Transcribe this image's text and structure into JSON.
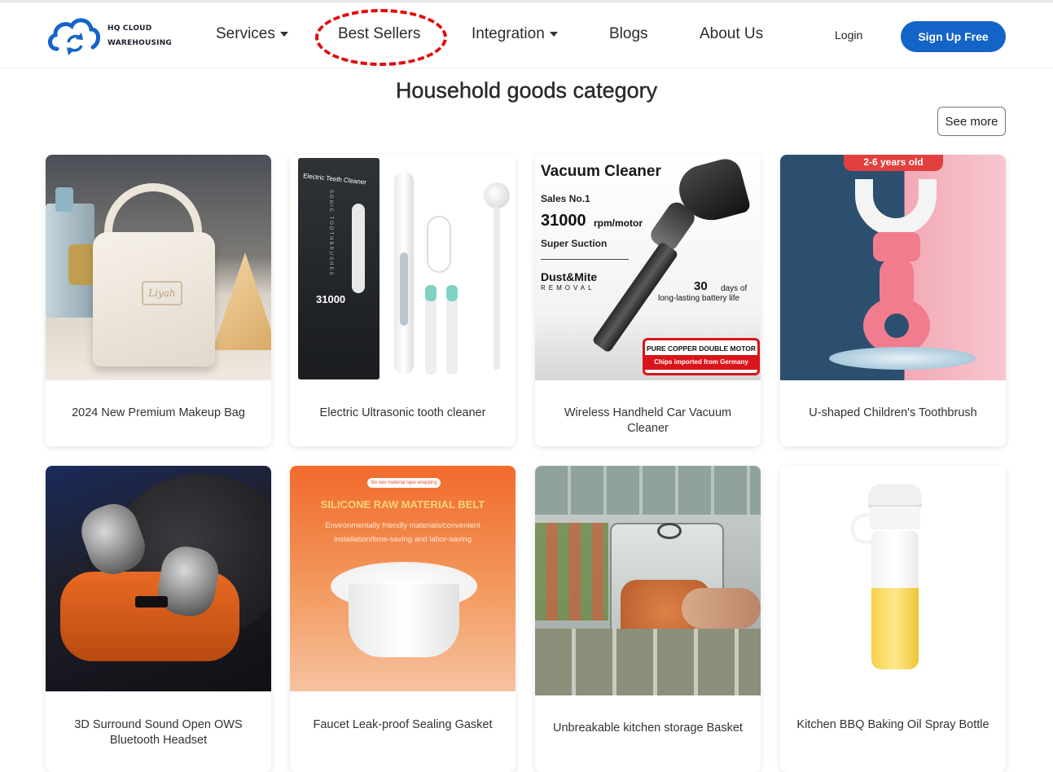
{
  "brand": {
    "line1": "HQ CLOUD",
    "line2": "WAREHOUSING",
    "accent": "#1464c8"
  },
  "nav": {
    "services": "Services",
    "best_sellers": "Best Sellers",
    "integration": "Integration",
    "blogs": "Blogs",
    "about": "About Us",
    "login": "Login",
    "signup": "Sign Up Free"
  },
  "section": {
    "title": "Household goods category",
    "see_more": "See more"
  },
  "products": [
    {
      "name": "2024 New Premium Makeup Bag",
      "image_text": [
        "Liyah"
      ]
    },
    {
      "name": "Electric Ultrasonic tooth cleaner",
      "image_text": [
        "Electric Teeth Cleaner",
        "SONIC TOOTHBRUSHES",
        "31000"
      ]
    },
    {
      "name": "Wireless Handheld Car Vacuum Cleaner",
      "image_text": [
        "Vacuum Cleaner",
        "Sales No.1",
        "31000",
        "rpm/motor",
        "Super Suction",
        "Dust&Mite",
        "REMOVAL",
        "30",
        "days of",
        "long-lasting battery life",
        "PURE COPPER DOUBLE MOTOR",
        "Chips imported from Germany"
      ]
    },
    {
      "name": "U-shaped Children's Toothbrush",
      "image_text": [
        "2-6 years old"
      ]
    },
    {
      "name": "3D Surround Sound Open OWS Bluetooth Headset",
      "image_text": []
    },
    {
      "name": "Faucet Leak-proof Sealing Gasket",
      "image_text": [
        "No raw material tape wrapping",
        "SILICONE RAW MATERIAL BELT",
        "Environmentally friendly materials/convenient",
        "installation/time-saving and labor-saving"
      ]
    },
    {
      "name": "Unbreakable kitchen storage Basket",
      "image_text": []
    },
    {
      "name": "Kitchen BBQ Baking Oil Spray Bottle",
      "image_text": []
    }
  ]
}
